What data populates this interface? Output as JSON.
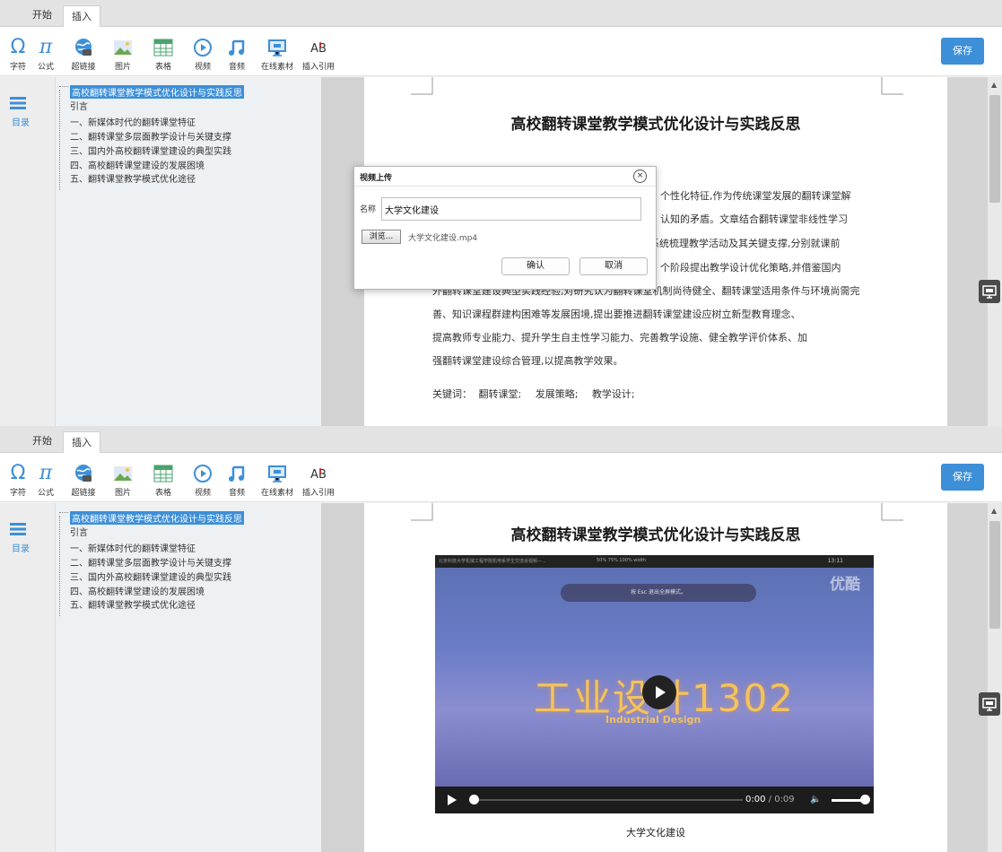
{
  "tabs": {
    "start": "开始",
    "insert": "插入"
  },
  "toolbar": {
    "items": [
      {
        "label": "字符",
        "icon": "omega-icon"
      },
      {
        "label": "公式",
        "icon": "pi-icon"
      },
      {
        "label": "超链接",
        "icon": "hyperlink-globe-icon"
      },
      {
        "label": "图片",
        "icon": "image-icon"
      },
      {
        "label": "表格",
        "icon": "table-icon"
      },
      {
        "label": "视频",
        "icon": "video-play-icon"
      },
      {
        "label": "音频",
        "icon": "music-note-icon"
      },
      {
        "label": "在线素材",
        "icon": "online-material-icon"
      },
      {
        "label": "插入引用",
        "icon": "citation-icon"
      }
    ],
    "icon_glyphs": {
      "omega": "Ω",
      "pi": "π",
      "cite_main": "AB",
      "cite_sup": "1"
    },
    "save_label": "保存"
  },
  "sidebar": {
    "label": "目录"
  },
  "outline": {
    "items": [
      "高校翻转课堂教学模式优化设计与实践反思",
      "引言",
      "一、新媒体时代的翻转课堂特征",
      "二、翻转课堂多层面教学设计与关键支撑",
      "三、国内外高校翻转课堂建设的典型实践",
      "四、高校翻转课堂建设的发展困境",
      "五、翻转课堂教学模式优化途径"
    ]
  },
  "document": {
    "title": "高校翻转课堂教学模式优化设计与实践反思",
    "body_lines_partial": [
      "个性化特征,作为传统课堂发展的翻转课堂解",
      "认知的矛盾。文章结合翻转课堂非线性学习",
      "系统梳理教学活动及其关键支撑,分别就课前",
      "个阶段提出教学设计优化策略,并借鉴国内"
    ],
    "body_lines_full": [
      "外翻转课堂建设典型实践经验,对研究认为翻转课堂机制尚待健全、翻转课堂适用条件与环境尚需完",
      "善、知识课程群建构困难等发展困境,提出要推进翻转课堂建设应树立新型教育理念、",
      "提高教师专业能力、提升学生自主性学习能力、完善教学设施、健全教学评价体系、加",
      "强翻转课堂建设综合管理,以提高教学效果。"
    ],
    "keywords_label": "关键词：",
    "keywords": [
      "翻转课堂;",
      "发展策略;",
      "教学设计;"
    ]
  },
  "dialog": {
    "title": "视频上传",
    "close_glyph": "×",
    "name_label": "名称",
    "name_value": "大学文化建设",
    "browse_label": "浏览...",
    "file_name": "大学文化建设.mp4",
    "ok_label": "确认",
    "cancel_label": "取消"
  },
  "video": {
    "top_title": "北京科技大学机械工程学院机电系学生交流会视频—...",
    "top_resolutions": "50%   75%   100%   width",
    "top_time": "13:11",
    "esc_hint": "按 Esc 退出全屏模式。",
    "watermark": "优酷",
    "frame_title": "工业设计1302",
    "frame_subtitle": "Industrial Design",
    "time_current": "0:00",
    "time_separator": " / ",
    "time_total": "0:09",
    "volume_glyph": "🔈",
    "progress_fraction": 0.0,
    "volume_fraction": 0.85,
    "caption": "大学文化建设"
  },
  "colors": {
    "accent": "#3d8fd8",
    "outline_selected": "#3d8fd8",
    "video_title": "#f5c35a"
  }
}
